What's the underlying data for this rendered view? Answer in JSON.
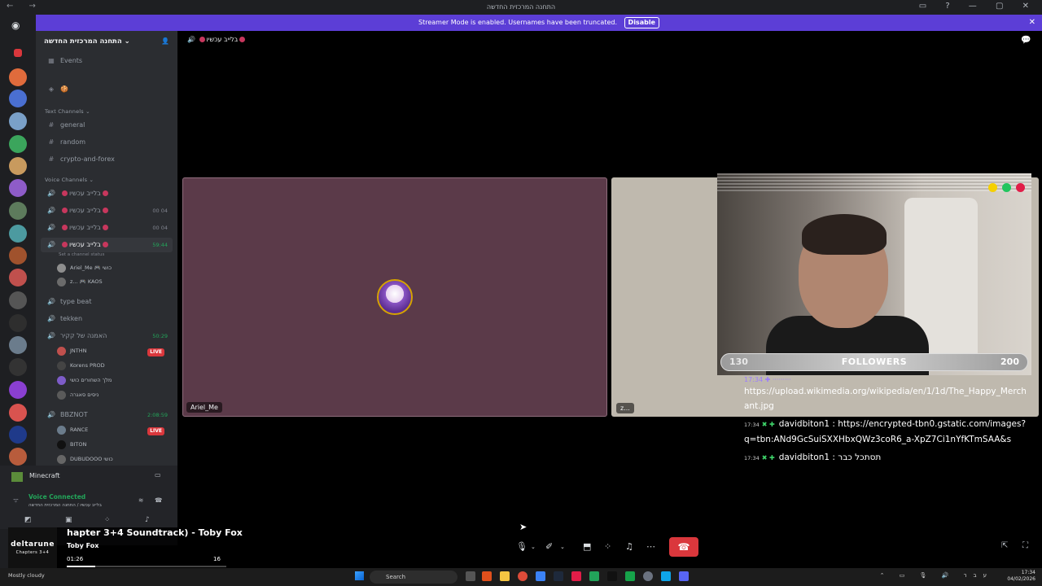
{
  "window": {
    "title": "התחנה המרכזית החדשה",
    "nav": "← →",
    "controls": "▭ ? — ▢ ✕"
  },
  "streamer": {
    "message": "Streamer Mode is enabled. Usernames have been truncated.",
    "disable_label": "Disable",
    "close": "✕"
  },
  "sidebar": {
    "guild_name": "התחנה המרכזית החדשה ⌄",
    "events_label": "Events",
    "text_category": "Text Channels ⌄",
    "text_channels": [
      {
        "name": "general"
      },
      {
        "name": "random"
      },
      {
        "name": "crypto-and-forex"
      }
    ],
    "voice_category": "Voice Channels ⌄",
    "voice_channels": [
      {
        "name": "בלייב עכשיו",
        "right": ""
      },
      {
        "name": "בלייב עכשיו",
        "right": "00 04"
      },
      {
        "name": "בלייב עכשיו",
        "right": "00 04"
      },
      {
        "name": "בלייב עכשיו",
        "right": "59:44"
      }
    ],
    "channel_status": "Set a channel status",
    "active_users": [
      {
        "name": "Ariel_Me",
        "tag": "🎮 כושי"
      },
      {
        "name": "z...",
        "tag": "🎮 KAOS"
      }
    ],
    "other_channels": [
      {
        "name": "type beat"
      },
      {
        "name": "tekken"
      },
      {
        "name": "האמנה של קקיר",
        "right": "50:29"
      }
    ],
    "kakir_users": [
      {
        "name": "JNTHN",
        "live": "LIVE"
      },
      {
        "name": "Korens",
        "tag": "PROD"
      },
      {
        "name": "מלך השחורים",
        "tag": "כושי"
      },
      {
        "name": "ניסים סאגרה",
        "tag": ""
      }
    ],
    "bbznot": {
      "name": "BBZNOT",
      "right": "2:08:59"
    },
    "bbznot_users": [
      {
        "name": "RANCE",
        "live": "LIVE"
      },
      {
        "name": "BITON",
        "tag": ""
      },
      {
        "name": "DUBUDOOO",
        "tag": "כושי"
      }
    ],
    "game_activity": "Minecraft",
    "voice_status": "Voice Connected",
    "voice_sub": "בלייב עכשיו / התחנה המרכזית החדשה"
  },
  "music": {
    "cover_title": "deltarune",
    "cover_sub": "Chapters 3+4",
    "song": "hapter 3+4 Soundtrack) - Toby Fox",
    "artist": "Toby Fox",
    "elapsed": "01:26",
    "duration": "16",
    "progress": 0.18
  },
  "stage": {
    "channel_name": "בלייב עכשיו",
    "tile1_name": "Ariel_Me",
    "tile2_name": "z..."
  },
  "overlay": {
    "followers_current": "130",
    "followers_label": "FOLLOWERS",
    "followers_goal": "200",
    "chat": [
      {
        "time": "",
        "user": "",
        "text": "https://upload.wikimedia.org/wikipedia/en/1/1d/The_Happy_Merchant.jpg"
      },
      {
        "time": "17:34",
        "user": "davidbiton1",
        "text": ": https://encrypted-tbn0.gstatic.com/images?q=tbn:ANd9GcSuiSXXHbxQWz3coR6_a-XpZ7Ci1nYfKTmSAA&s"
      },
      {
        "time": "17:34",
        "user": "davidbiton1",
        "text": ": תסתכל כבר"
      }
    ]
  },
  "taskbar": {
    "weather": "Mostly cloudy",
    "search": "Search",
    "time": "17:34",
    "date": "04/02/2026",
    "lang": "עבר"
  },
  "colors": {
    "accent": "#5c3ed6",
    "danger": "#da373c",
    "online": "#23a55a"
  }
}
